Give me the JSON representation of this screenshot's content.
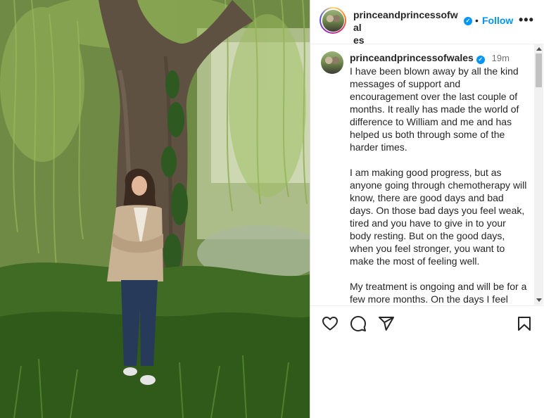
{
  "post": {
    "username": "princeandprincessofwales",
    "username_wrapped_line1": "princeandprincessofwal",
    "username_wrapped_line2": "es",
    "follow_label": "Follow",
    "separator": "•",
    "more_label": "•••",
    "time_ago": "19m",
    "verified_mark": "✓"
  },
  "caption": {
    "paragraphs": [
      "I have been blown away by all the kind messages of support and encouragement over the last couple of months. It really has made the world of difference to William and me and has helped us both through some of the harder times.",
      "I am making good progress, but as anyone going through chemotherapy will know, there are good days and bad days. On those bad days you feel weak, tired and you have to give in to your body resting. But on the good days, when you feel stronger, you want to make the most of feeling well.",
      "My treatment is ongoing and will be for a few more months. On the days I feel"
    ]
  },
  "icons": {
    "like": "heart-icon",
    "comment": "comment-icon",
    "share": "share-icon",
    "save": "bookmark-icon"
  },
  "colors": {
    "accent": "#0095f6",
    "text": "#262626",
    "muted": "#737373"
  }
}
